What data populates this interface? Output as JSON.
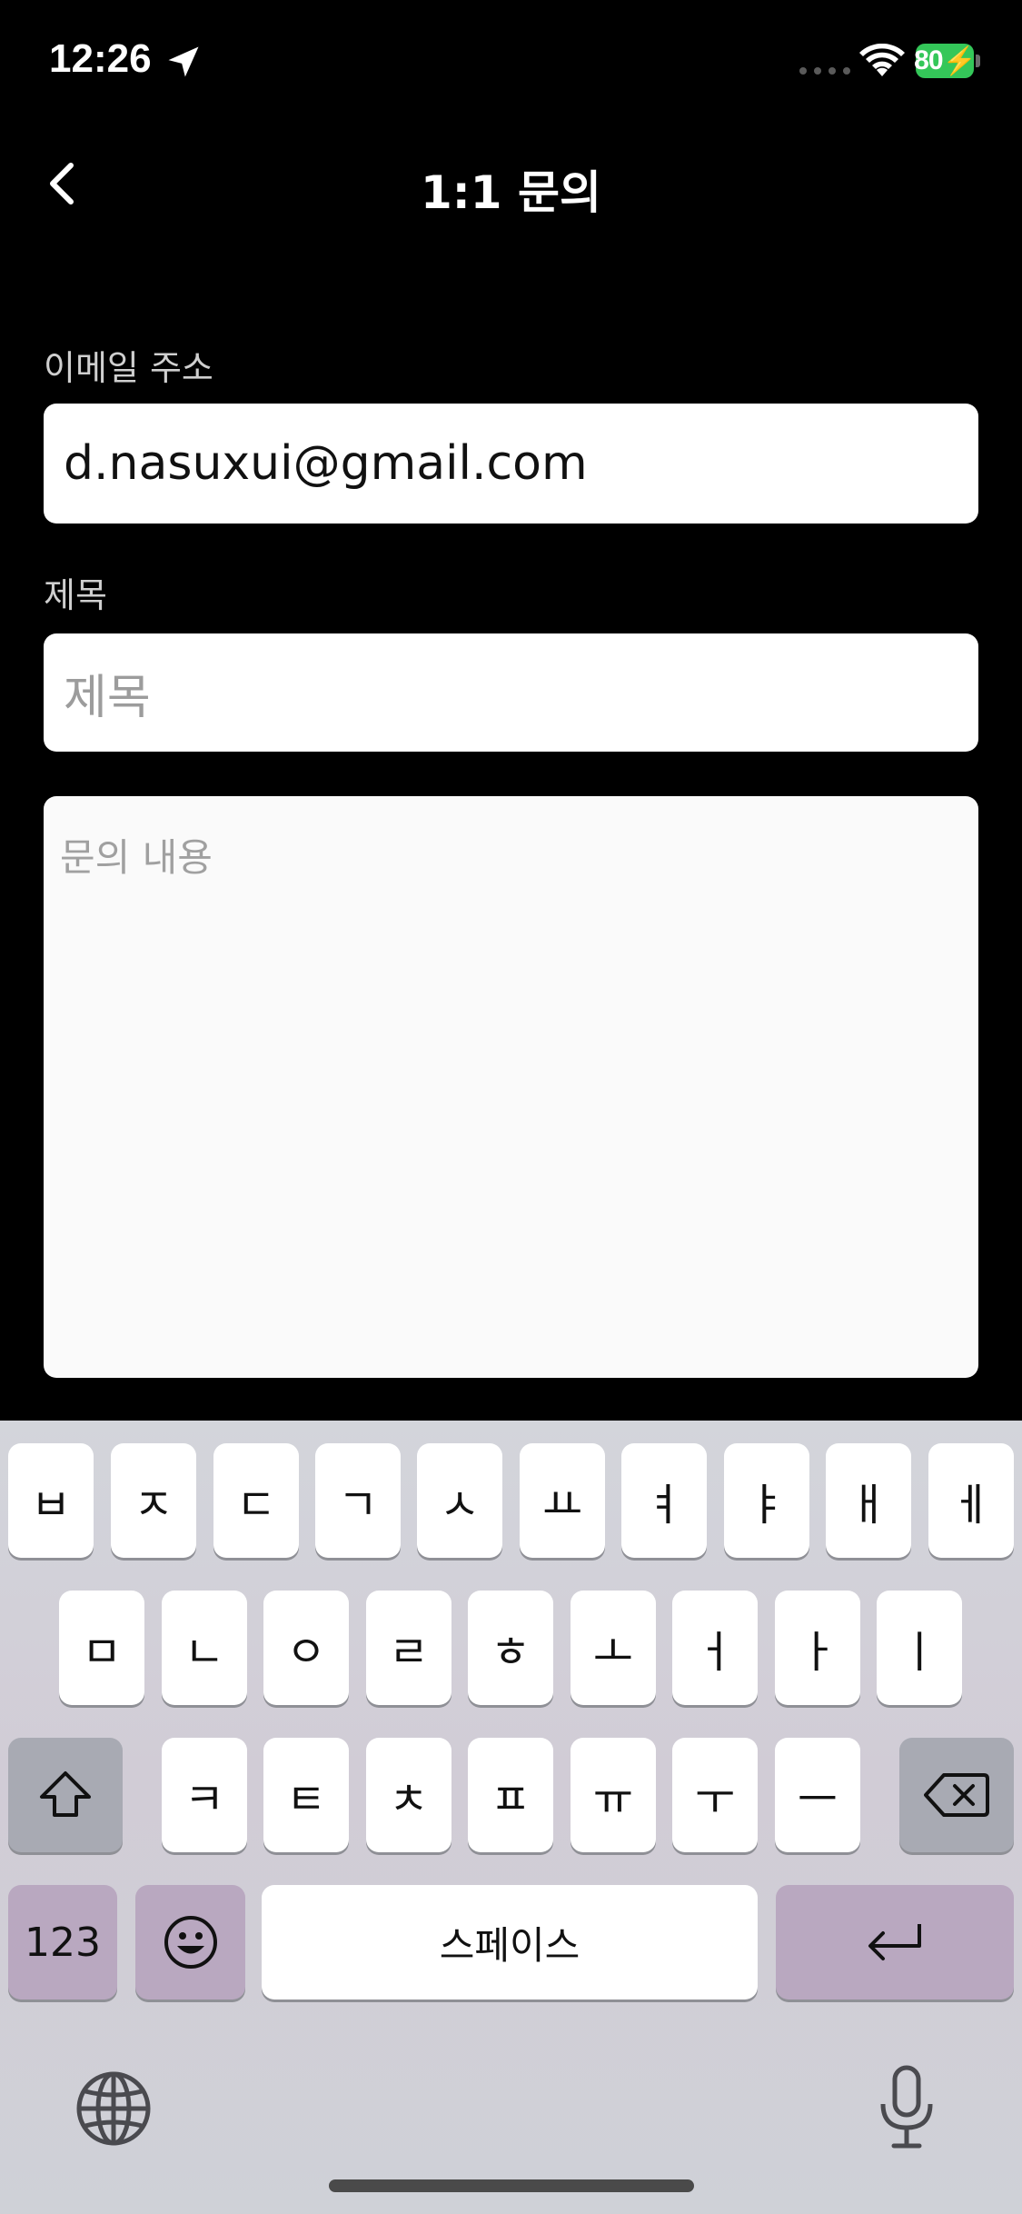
{
  "status_bar": {
    "time": "12:26",
    "battery": "80"
  },
  "nav": {
    "title": "1:1 문의"
  },
  "form": {
    "email_label": "이메일 주소",
    "email_value": "d.nasuxui@gmail.com",
    "subject_label": "제목",
    "subject_placeholder": "제목",
    "content_placeholder": "문의 내용"
  },
  "keyboard": {
    "row1": [
      "ㅂ",
      "ㅈ",
      "ㄷ",
      "ㄱ",
      "ㅅ",
      "ㅛ",
      "ㅕ",
      "ㅑ",
      "ㅐ",
      "ㅔ"
    ],
    "row2": [
      "ㅁ",
      "ㄴ",
      "ㅇ",
      "ㄹ",
      "ㅎ",
      "ㅗ",
      "ㅓ",
      "ㅏ",
      "ㅣ"
    ],
    "row3": [
      "ㅋ",
      "ㅌ",
      "ㅊ",
      "ㅍ",
      "ㅠ",
      "ㅜ",
      "ㅡ"
    ],
    "numbers_label": "123",
    "space_label": "스페이스"
  }
}
